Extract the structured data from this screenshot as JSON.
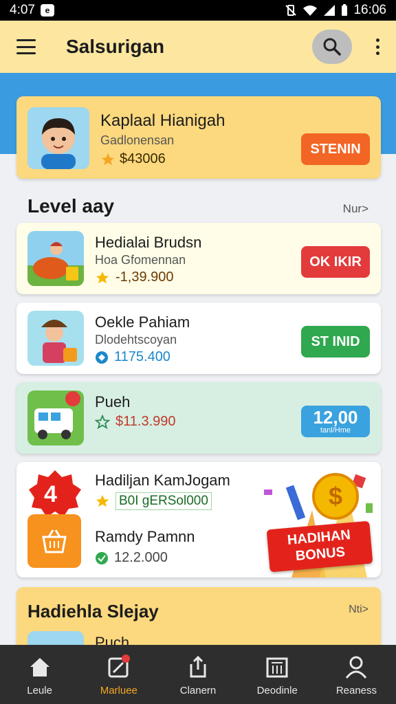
{
  "status_bar": {
    "time_left": "4:07",
    "notif_icon": "notification-badge-icon",
    "notif_glyph": "e",
    "time_right": "16:06"
  },
  "app_bar": {
    "title": "Salsurigan"
  },
  "profile": {
    "name": "Kaplaal Hianigah",
    "subtitle": "Gadlonensan",
    "value": "$43006",
    "button": "STENIN",
    "button_color": "#f26524"
  },
  "section_level": {
    "title": "Level aay",
    "more": "Nur>"
  },
  "items": [
    {
      "name": "Hedialai Brudsn",
      "subtitle": "Hoa Gfomennan",
      "value": "-1,39.900",
      "button": "OK IKIR",
      "button_color": "#e33b3b",
      "value_color": "#6b3a00",
      "card_color": "#fffde8",
      "icon": "coin-star-icon"
    },
    {
      "name": "Oekle Pahiam",
      "subtitle": "Dlodehtscoyan",
      "value": "1175.400",
      "button": "ST INID",
      "button_color": "#2fa84f",
      "value_color": "#1a88c9",
      "card_color": "#ffffff",
      "icon": "globe-icon"
    },
    {
      "name": "Pueh",
      "subtitle": "",
      "value": "$11.3.990",
      "button": "12,00",
      "button_sub": "tanl/Hme",
      "button_color": "#3aa2de",
      "value_color": "#c0392b",
      "card_color": "#d6efe2",
      "icon": "star-icon"
    }
  ],
  "bonus": {
    "title": "Hadiljan KamJogam",
    "code": "B0I gERSol000",
    "badge": "4",
    "item_name": "Ramdy Pamnn",
    "item_value": "12.2.000",
    "label_line1": "HADIHAN",
    "label_line2": "BONUS"
  },
  "section_bottom": {
    "title": "Hadiehla Slejay",
    "more": "Nti>",
    "item": "Puch"
  },
  "bottom_nav": [
    {
      "label": "Leule",
      "icon": "home-icon",
      "active": false
    },
    {
      "label": "Marluee",
      "icon": "tag-icon",
      "active": true
    },
    {
      "label": "Clanern",
      "icon": "share-icon",
      "active": false
    },
    {
      "label": "Deodinle",
      "icon": "document-icon",
      "active": false
    },
    {
      "label": "Reaness",
      "icon": "profile-icon",
      "active": false
    }
  ]
}
